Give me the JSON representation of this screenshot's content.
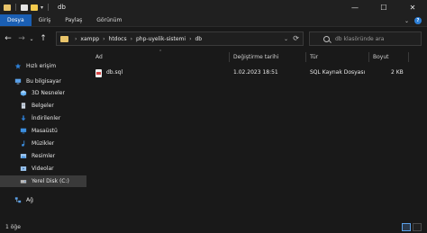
{
  "window": {
    "title": "db",
    "controls": {
      "minimize": "—",
      "maximize": "☐",
      "close": "✕"
    }
  },
  "ribbon": {
    "tabs": [
      "Dosya",
      "Giriş",
      "Paylaş",
      "Görünüm"
    ],
    "active_tab": "Dosya"
  },
  "nav": {
    "back": "←",
    "forward": "→",
    "recent": "⌄",
    "up": "↑",
    "breadcrumbs": [
      "xampp",
      "htdocs",
      "php-uyelik-sistemi",
      "db"
    ],
    "refresh": "⟳",
    "search_placeholder": "db klasöründe ara"
  },
  "sidebar": {
    "items": [
      {
        "label": "Hızlı erişim",
        "icon": "star-icon",
        "color": "#2d7fd6"
      },
      {
        "label": "Bu bilgisayar",
        "icon": "computer-icon",
        "color": "#5aa0e8"
      },
      {
        "label": "3D Nesneler",
        "icon": "cube-icon",
        "color": "#62b0f5"
      },
      {
        "label": "Belgeler",
        "icon": "documents-icon",
        "color": "#cfd8e3"
      },
      {
        "label": "İndirilenler",
        "icon": "download-icon",
        "color": "#2d7fd6"
      },
      {
        "label": "Masaüstü",
        "icon": "desktop-icon",
        "color": "#3c8fe0"
      },
      {
        "label": "Müzikler",
        "icon": "music-icon",
        "color": "#3c8fe0"
      },
      {
        "label": "Resimler",
        "icon": "pictures-icon",
        "color": "#9ac4ee"
      },
      {
        "label": "Videolar",
        "icon": "video-icon",
        "color": "#9ac4ee"
      },
      {
        "label": "Yerel Disk (C:)",
        "icon": "disk-icon",
        "color": "#bcbcbc"
      },
      {
        "label": "Ağ",
        "icon": "network-icon",
        "color": "#5aa0e8"
      }
    ],
    "selected": "Yerel Disk (C:)"
  },
  "table": {
    "columns": [
      "Ad",
      "Değiştirme tarihi",
      "Tür",
      "Boyut"
    ],
    "rows": [
      {
        "name": "db.sql",
        "modified": "1.02.2023 18:51",
        "type": "SQL Kaynak Dosyası",
        "size": "2 KB"
      }
    ]
  },
  "status": {
    "item_count": "1 öğe"
  }
}
